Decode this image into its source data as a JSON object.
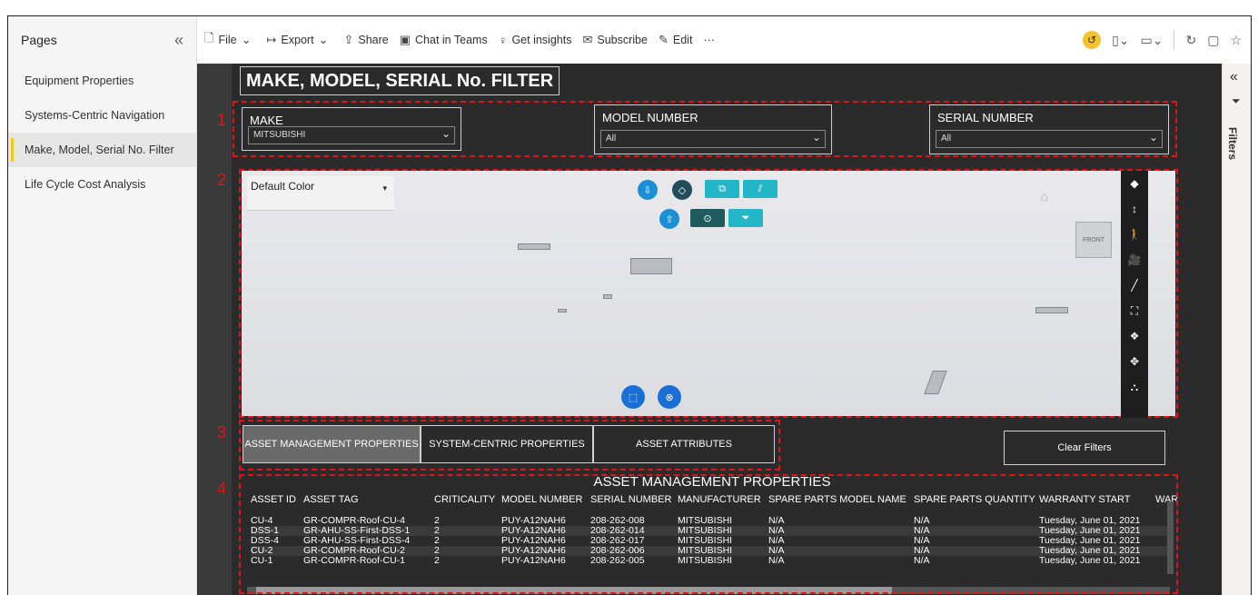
{
  "sidebar": {
    "title": "Pages",
    "items": [
      {
        "label": "Equipment Properties"
      },
      {
        "label": "Systems-Centric Navigation"
      },
      {
        "label": "Make, Model, Serial No. Filter"
      },
      {
        "label": "Life Cycle Cost Analysis"
      }
    ],
    "active_index": 2
  },
  "toolbar": {
    "file": "File",
    "export": "Export",
    "share": "Share",
    "chat": "Chat in Teams",
    "insights": "Get insights",
    "subscribe": "Subscribe",
    "edit": "Edit",
    "more": "···"
  },
  "filters_pane": {
    "label": "Filters"
  },
  "report": {
    "title": "MAKE, MODEL, SERIAL No. FILTER",
    "region_numbers": [
      "1",
      "2",
      "3",
      "4"
    ],
    "slicers": [
      {
        "label": "MAKE",
        "value": "MITSUBISHI"
      },
      {
        "label": "MODEL NUMBER",
        "value": "All"
      },
      {
        "label": "SERIAL NUMBER",
        "value": "All"
      }
    ],
    "viewer": {
      "color_select": "Default Color",
      "cube_label": "FRONT"
    },
    "tabs": [
      {
        "label": "ASSET MANAGEMENT PROPERTIES",
        "active": true
      },
      {
        "label": "SYSTEM-CENTRIC PROPERTIES",
        "active": false
      },
      {
        "label": "ASSET ATTRIBUTES",
        "active": false
      }
    ],
    "clear_filters": "Clear Filters",
    "table": {
      "title": "ASSET MANAGEMENT PROPERTIES",
      "columns": [
        "ASSET ID",
        "ASSET TAG",
        "CRITICALITY",
        "MODEL NUMBER",
        "SERIAL NUMBER",
        "MANUFACTURER",
        "SPARE PARTS MODEL NAME",
        "SPARE PARTS QUANTITY",
        "WARRANTY START",
        "WAR"
      ],
      "rows": [
        [
          "CU-4",
          "GR-COMPR-Roof-CU-4",
          "2",
          "PUY-A12NAH6",
          "208-262-008",
          "MITSUBISHI",
          "N/A",
          "N/A",
          "Tuesday, June 01, 2021"
        ],
        [
          "DSS-1",
          "GR-AHU-SS-First-DSS-1",
          "2",
          "PUY-A12NAH6",
          "208-262-014",
          "MITSUBISHI",
          "N/A",
          "N/A",
          "Tuesday, June 01, 2021"
        ],
        [
          "DSS-4",
          "GR-AHU-SS-First-DSS-4",
          "2",
          "PUY-A12NAH6",
          "208-262-017",
          "MITSUBISHI",
          "N/A",
          "N/A",
          "Tuesday, June 01, 2021"
        ],
        [
          "CU-2",
          "GR-COMPR-Roof-CU-2",
          "2",
          "PUY-A12NAH6",
          "208-262-006",
          "MITSUBISHI",
          "N/A",
          "N/A",
          "Tuesday, June 01, 2021"
        ],
        [
          "CU-1",
          "GR-COMPR-Roof-CU-1",
          "2",
          "PUY-A12NAH6",
          "208-262-005",
          "MITSUBISHI",
          "N/A",
          "N/A",
          "Tuesday, June 01, 2021"
        ]
      ]
    }
  },
  "colors": {
    "accent": "#f2c811",
    "annotation": "#e0141a",
    "viewer_button": "#1a8fd6",
    "teal": "#22b6c6"
  }
}
